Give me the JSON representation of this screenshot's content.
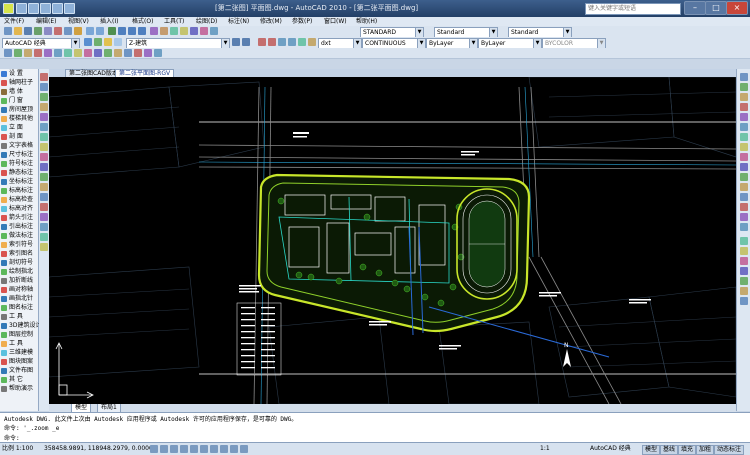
{
  "window": {
    "title": "[第二张图] 平面图.dwg - AutoCAD 2010 - [第二张平面图.dwg]",
    "search_placeholder": "键入关键字或短语"
  },
  "menu": [
    "文件(F)",
    "编辑(E)",
    "视图(V)",
    "插入(I)",
    "格式(O)",
    "工具(T)",
    "绘图(D)",
    "标注(N)",
    "修改(M)",
    "参数(P)",
    "窗口(W)",
    "帮助(H)"
  ],
  "toolbar": {
    "workspace": "AutoCAD 经典",
    "layer_name": "Z-建筑",
    "text_style": "STANDARD",
    "dim_style": "Standard",
    "table_style": "Standard",
    "layer_combo": "dxt",
    "color_combo": "ByLayer",
    "linetype_combo": "CONTINUOUS",
    "lineweight_combo": "ByLayer",
    "plotstyle_combo": "BYCOLOR"
  },
  "left_panel": {
    "items": [
      {
        "label": "设  置",
        "color": "#3a7bd5"
      },
      {
        "label": "轴网柱子",
        "color": "#d9534f"
      },
      {
        "label": "墙  体",
        "color": "#8a6d3b"
      },
      {
        "label": "门  窗",
        "color": "#5cb85c"
      },
      {
        "label": "房间屋顶",
        "color": "#337ab7"
      },
      {
        "label": "楼梯其他",
        "color": "#f0ad4e"
      },
      {
        "label": "立  面",
        "color": "#5bc0de"
      },
      {
        "label": "剖  面",
        "color": "#d9534f"
      },
      {
        "label": "文字表格",
        "color": "#777777"
      },
      {
        "label": "尺寸标注",
        "color": "#337ab7"
      },
      {
        "label": "符号标注",
        "color": "#5cb85c"
      },
      {
        "label": "静态标注",
        "color": "#d9534f"
      },
      {
        "label": "坐标标注",
        "color": "#337ab7"
      },
      {
        "label": "标高标注",
        "color": "#5cb85c"
      },
      {
        "label": "标高检查",
        "color": "#f0ad4e"
      },
      {
        "label": "标高对齐",
        "color": "#5bc0de"
      },
      {
        "label": "箭头引注",
        "color": "#d9534f"
      },
      {
        "label": "引出标注",
        "color": "#337ab7"
      },
      {
        "label": "做法标注",
        "color": "#5cb85c"
      },
      {
        "label": "索引符号",
        "color": "#f0ad4e"
      },
      {
        "label": "索引图名",
        "color": "#d9534f"
      },
      {
        "label": "剖切符号",
        "color": "#337ab7"
      },
      {
        "label": "绘制指北",
        "color": "#5cb85c"
      },
      {
        "label": "加折断线",
        "color": "#777777"
      },
      {
        "label": "画对称轴",
        "color": "#d9534f"
      },
      {
        "label": "画指北针",
        "color": "#337ab7"
      },
      {
        "label": "图名标注",
        "color": "#5cb85c"
      },
      {
        "label": "工  具",
        "color": "#777777"
      },
      {
        "label": "3D建筑设计",
        "color": "#337ab7"
      },
      {
        "label": "图层控制",
        "color": "#5cb85c"
      },
      {
        "label": "工  具",
        "color": "#f0ad4e"
      },
      {
        "label": "三维建模",
        "color": "#5bc0de"
      },
      {
        "label": "图块图案",
        "color": "#d9534f"
      },
      {
        "label": "文件布图",
        "color": "#337ab7"
      },
      {
        "label": "其  它",
        "color": "#5cb85c"
      },
      {
        "label": "帮助演示",
        "color": "#777777"
      }
    ]
  },
  "doc_tabs": [
    "第二张图CAD版本-RGV",
    "第二张平面图-RGV"
  ],
  "canvas": {
    "background": "#000000",
    "site_color": "#c8e62a",
    "north_label": "N"
  },
  "layout_tabs": [
    "模型",
    "布局1"
  ],
  "command": {
    "lines": [
      "Autodesk DWG.  此文件上次由 Autodesk 应用程序或 Autodesk 许可的应用程序保存，是可靠的 DWG。",
      "命令: '_.zoom _e",
      "命令:"
    ]
  },
  "status": {
    "scale": "比例 1:100",
    "coords": "358458.9891, 118948.2979, 0.0000",
    "annotation_scale": "1:1",
    "workspace": "AutoCAD 经典",
    "buttons": [
      "模型",
      "基线",
      "填充",
      "加粗",
      "动态标注"
    ]
  }
}
